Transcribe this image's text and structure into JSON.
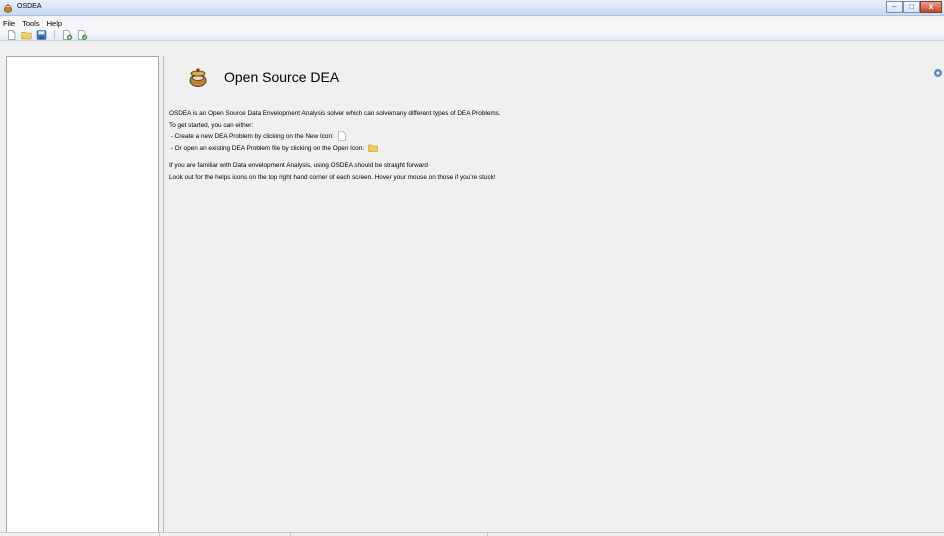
{
  "window": {
    "title": "OSDEA",
    "app_icon": "pot-icon",
    "controls": {
      "minimize": "–",
      "maximize": "□",
      "close": "x"
    }
  },
  "menubar": {
    "items": [
      {
        "label": "File"
      },
      {
        "label": "Tools"
      },
      {
        "label": "Help"
      }
    ]
  },
  "toolbar": {
    "buttons": [
      "new-file-icon",
      "open-folder-icon",
      "save-icon",
      "add-document-icon",
      "add-document-alt-icon"
    ]
  },
  "main": {
    "header_title": "Open Source DEA",
    "header_icon": "pot-icon",
    "help_icon": "help-icon",
    "intro": "OSDEA is an Open Source Data Envelopment Analysis solver which can solvemany different types of DEA Problems.",
    "get_started": "To get started, you can either:",
    "option_new": "- Create a new DEA Problem by clicking on the New Icon:",
    "option_open": "- Or open an existing DEA Problem file by clicking on the Open Icon:",
    "familiar": "If you are familiar with Data envelopment Analysis, using OSDEA should be straight forward",
    "helps_hint": "Look out for the helps icons on the top right hand corner of each screen. Hover your mouse on those if you're stuck!"
  },
  "colors": {
    "titlebar": "#d9e6f6",
    "background": "#f0f0f0",
    "panel": "#ffffff",
    "folder": "#f3c95a",
    "close": "#c6452a"
  }
}
